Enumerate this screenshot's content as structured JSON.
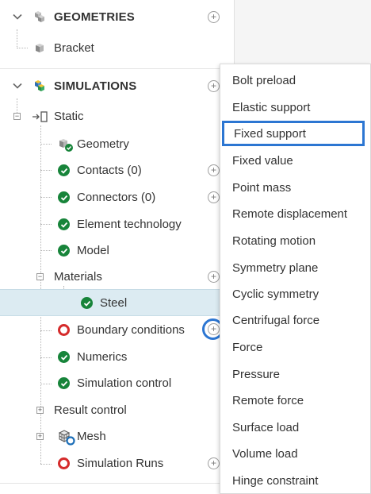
{
  "geometries": {
    "title": "GEOMETRIES",
    "items": [
      {
        "label": "Bracket"
      }
    ]
  },
  "simulations": {
    "title": "SIMULATIONS",
    "static": {
      "label": "Static",
      "children": [
        {
          "label": "Geometry"
        },
        {
          "label": "Contacts (0)"
        },
        {
          "label": "Connectors (0)"
        },
        {
          "label": "Element technology"
        },
        {
          "label": "Model"
        },
        {
          "label": "Materials"
        },
        {
          "label": "Steel"
        },
        {
          "label": "Boundary conditions"
        },
        {
          "label": "Numerics"
        },
        {
          "label": "Simulation control"
        },
        {
          "label": "Result control"
        },
        {
          "label": "Mesh"
        },
        {
          "label": "Simulation Runs"
        }
      ]
    }
  },
  "context_menu": {
    "highlighted": "Fixed support",
    "items": [
      {
        "label": "Bolt preload"
      },
      {
        "label": "Elastic support"
      },
      {
        "label": "Fixed support"
      },
      {
        "label": "Fixed value"
      },
      {
        "label": "Point mass"
      },
      {
        "label": "Remote displacement"
      },
      {
        "label": "Rotating motion"
      },
      {
        "label": "Symmetry plane"
      },
      {
        "label": "Cyclic symmetry"
      },
      {
        "label": "Centrifugal force"
      },
      {
        "label": "Force"
      },
      {
        "label": "Pressure"
      },
      {
        "label": "Remote force"
      },
      {
        "label": "Surface load"
      },
      {
        "label": "Volume load"
      },
      {
        "label": "Hinge constraint"
      }
    ]
  },
  "colors": {
    "status_ok": "#17843a",
    "status_error": "#d52b2b",
    "selection": "#dcebf2",
    "focus": "#2c76d2"
  }
}
